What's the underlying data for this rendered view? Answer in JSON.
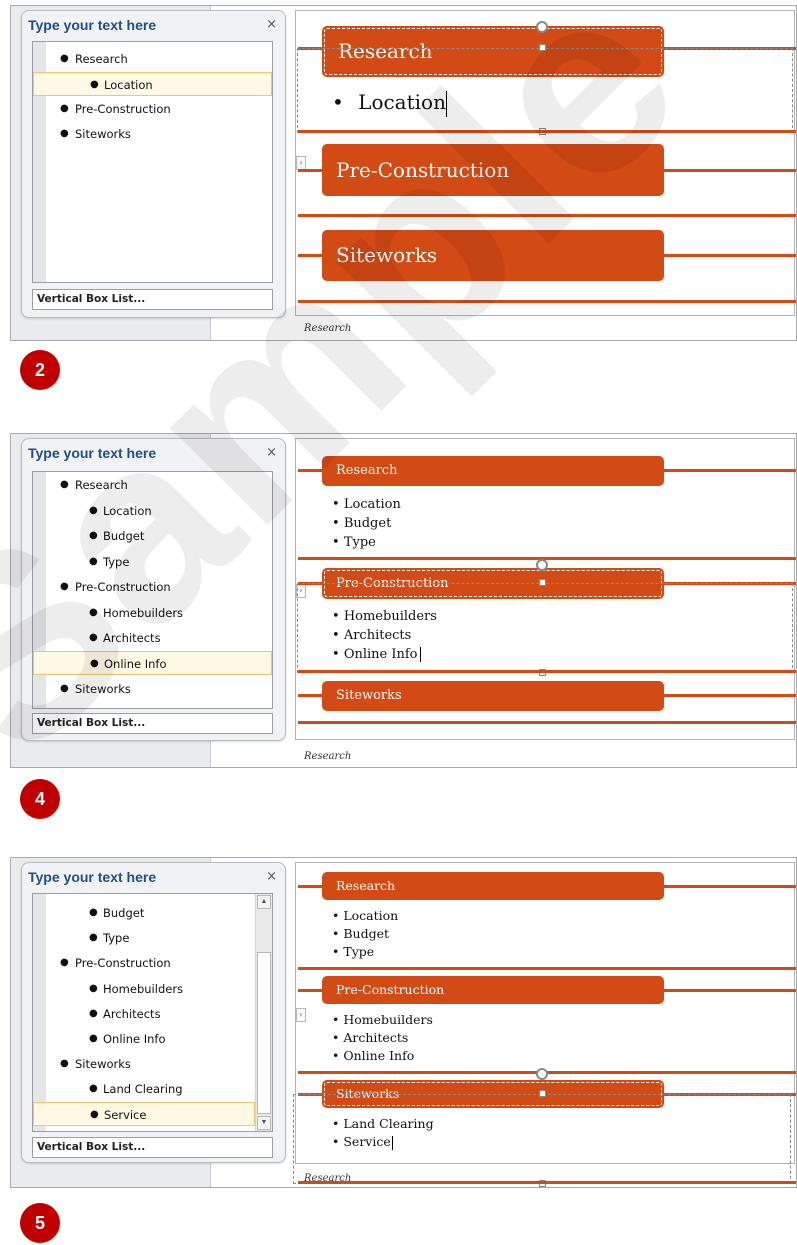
{
  "colors": {
    "accent": "#d24a14",
    "pane_title": "#1c4f8c",
    "badge": "#c00000"
  },
  "watermark": "Sample",
  "steps": [
    {
      "badge": "2",
      "pane": {
        "title": "Type your text here",
        "close": "×",
        "footer": "Vertical Box List...",
        "items": [
          "Research",
          "Location",
          "Pre-Construction",
          "Siteworks"
        ]
      },
      "shapes": [
        "Research",
        "Pre-Construction",
        "Siteworks"
      ],
      "bullets": [
        "Location"
      ],
      "caption": "Research"
    },
    {
      "badge": "4",
      "pane": {
        "title": "Type your text here",
        "close": "×",
        "footer": "Vertical Box List...",
        "items": [
          "Research",
          "Location",
          "Budget",
          "Type",
          "Pre-Construction",
          "Homebuilders",
          "Architects",
          "Online Info",
          "Siteworks"
        ]
      },
      "shapes": [
        "Research",
        "Pre-Construction",
        "Siteworks"
      ],
      "bullets_research": [
        "Location",
        "Budget",
        "Type"
      ],
      "bullets_preconstruction": [
        "Homebuilders",
        "Architects",
        "Online Info"
      ],
      "caption": "Research"
    },
    {
      "badge": "5",
      "pane": {
        "title": "Type your text here",
        "close": "×",
        "footer": "Vertical Box List...",
        "items": [
          "Budget",
          "Type",
          "Pre-Construction",
          "Homebuilders",
          "Architects",
          "Online Info",
          "Siteworks",
          "Land Clearing",
          "Service"
        ]
      },
      "shapes": [
        "Research",
        "Pre-Construction",
        "Siteworks"
      ],
      "bullets_research": [
        "Location",
        "Budget",
        "Type"
      ],
      "bullets_preconstruction": [
        "Homebuilders",
        "Architects",
        "Online Info"
      ],
      "bullets_siteworks": [
        "Land Clearing",
        "Service"
      ],
      "caption": "Research"
    }
  ]
}
